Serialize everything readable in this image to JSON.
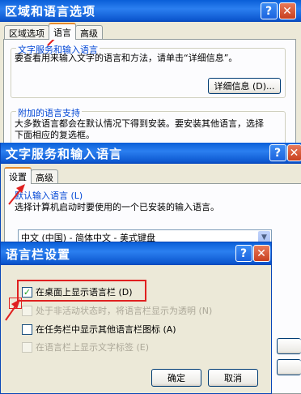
{
  "win1": {
    "title": "区域和语言选项",
    "tabs": [
      "区域选项",
      "语言",
      "高级"
    ],
    "group1_title": "文字服务和输入语言",
    "group1_text": "要查看用来输入文字的语言和方法，请单击“详细信息”。",
    "details_button": "详细信息 (D)...",
    "group2_title": "附加的语言支持",
    "group2_text_line1": "大多数语言都会在默认情况下得到安装。要安装其他语言，选择",
    "group2_text_line2": "下面相应的复选框。"
  },
  "win2": {
    "title": "文字服务和输入语言",
    "tabs": [
      "设置",
      "高级"
    ],
    "group_title": "默认输入语言 (L)",
    "group_text": "选择计算机启动时要使用的一个已安装的输入语言。",
    "select_value": "中文 (中国) - 简体中文 - 美式键盘"
  },
  "win3": {
    "title": "语言栏设置",
    "options": [
      {
        "label": "在桌面上显示语言栏 (D)",
        "checked": true,
        "disabled": false
      },
      {
        "label": "处于非活动状态时，将语言栏显示为透明 (N)",
        "checked": false,
        "disabled": true
      },
      {
        "label": "在任务栏中显示其他语言栏图标 (A)",
        "checked": false,
        "disabled": false
      },
      {
        "label": "在语言栏上显示文字标签 (E)",
        "checked": false,
        "disabled": true
      }
    ],
    "ok_button": "确定",
    "cancel_button": "取消"
  },
  "titlebar_buttons": {
    "help": "?",
    "close": "✕"
  },
  "colors": {
    "titlebar": "#0d58d0",
    "accent_red": "#e02020",
    "group_title": "#0046d5"
  }
}
